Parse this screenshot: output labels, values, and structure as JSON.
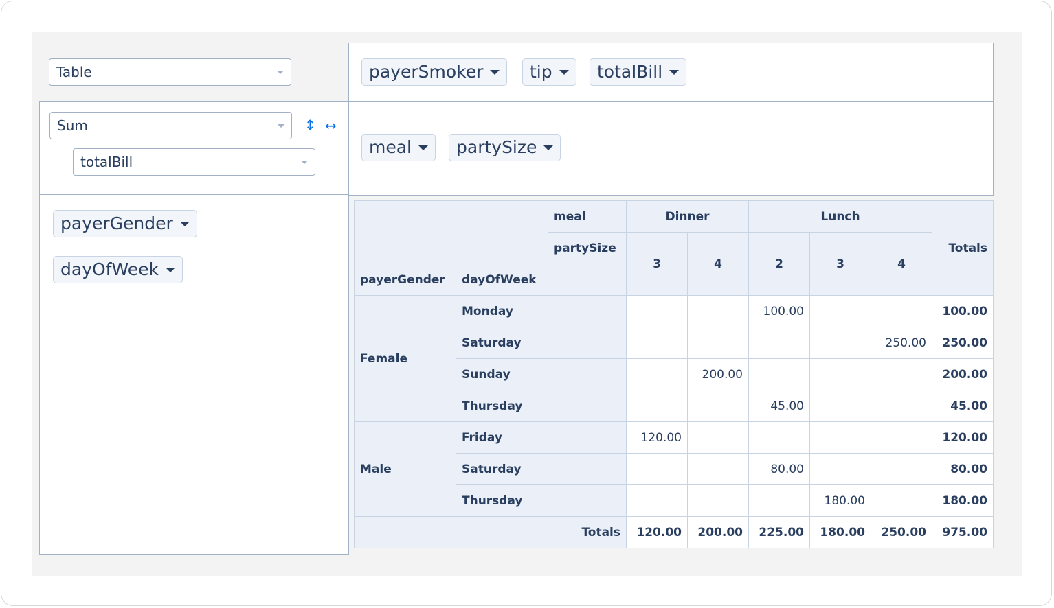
{
  "renderer_select": {
    "value": "Table"
  },
  "aggregator": {
    "select_value": "Sum",
    "attr_value": "totalBill",
    "row_order_icon": "↕",
    "col_order_icon": "↔"
  },
  "unused_attrs": [
    "payerSmoker",
    "tip",
    "totalBill"
  ],
  "col_attrs": [
    "meal",
    "partySize"
  ],
  "row_attrs": [
    "payerGender",
    "dayOfWeek"
  ],
  "table": {
    "col_attr_labels": [
      "meal",
      "partySize"
    ],
    "row_attr_labels": [
      "payerGender",
      "dayOfWeek"
    ],
    "meal_headers": [
      {
        "label": "Dinner",
        "span": 2
      },
      {
        "label": "Lunch",
        "span": 3
      }
    ],
    "party_size_headers": [
      "3",
      "4",
      "2",
      "3",
      "4"
    ],
    "totals_label": "Totals",
    "groups": [
      {
        "gender": "Female",
        "rows": [
          {
            "day": "Monday",
            "cells": [
              "",
              "",
              "100.00",
              "",
              ""
            ],
            "total": "100.00"
          },
          {
            "day": "Saturday",
            "cells": [
              "",
              "",
              "",
              "",
              "250.00"
            ],
            "total": "250.00"
          },
          {
            "day": "Sunday",
            "cells": [
              "",
              "200.00",
              "",
              "",
              ""
            ],
            "total": "200.00"
          },
          {
            "day": "Thursday",
            "cells": [
              "",
              "",
              "45.00",
              "",
              ""
            ],
            "total": "45.00"
          }
        ]
      },
      {
        "gender": "Male",
        "rows": [
          {
            "day": "Friday",
            "cells": [
              "120.00",
              "",
              "",
              "",
              ""
            ],
            "total": "120.00"
          },
          {
            "day": "Saturday",
            "cells": [
              "",
              "",
              "80.00",
              "",
              ""
            ],
            "total": "80.00"
          },
          {
            "day": "Thursday",
            "cells": [
              "",
              "",
              "",
              "180.00",
              ""
            ],
            "total": "180.00"
          }
        ]
      }
    ],
    "col_totals": [
      "120.00",
      "200.00",
      "225.00",
      "180.00",
      "250.00"
    ],
    "grand_total": "975.00"
  }
}
